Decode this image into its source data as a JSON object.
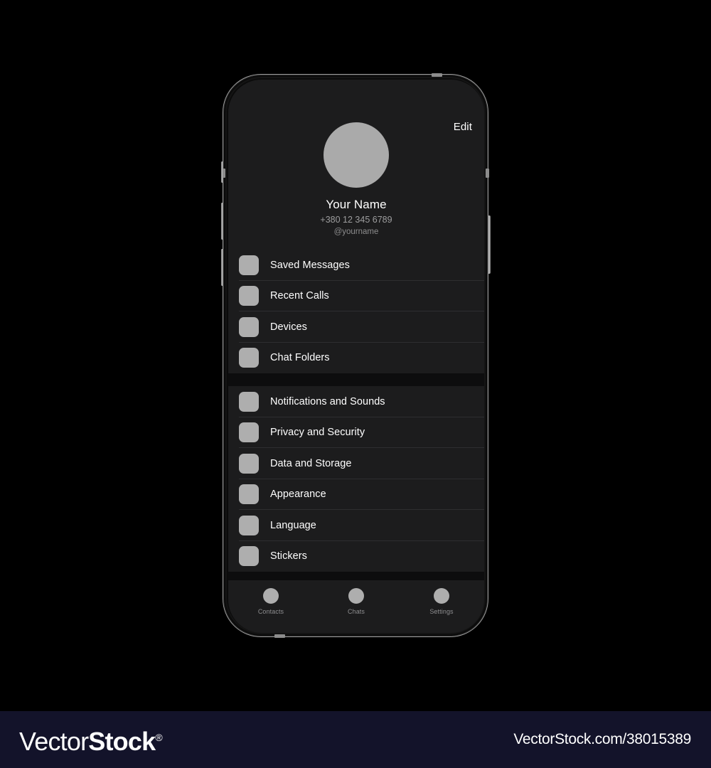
{
  "page": {
    "background_color": "#000000"
  },
  "device": {
    "type": "smartphone-mockup",
    "frame_color": "#9b9b9b",
    "screen_color": "#1c1c1d",
    "buttons": [
      {
        "name": "silent-switch"
      },
      {
        "name": "volume-up-button"
      },
      {
        "name": "volume-down-button"
      },
      {
        "name": "power-button"
      }
    ]
  },
  "screen": {
    "app": "messenger-settings",
    "header": {
      "edit_label": "Edit",
      "avatar_color": "#aaaaaa",
      "name": "Your Name",
      "phone": "+380 12 345 6789",
      "username": "@yourname"
    },
    "groups": [
      {
        "id": "group-1",
        "rows": [
          {
            "label": "Saved Messages",
            "icon": "saved-messages-icon"
          },
          {
            "label": "Recent Calls",
            "icon": "recent-calls-icon"
          },
          {
            "label": "Devices",
            "icon": "devices-icon"
          },
          {
            "label": "Chat Folders",
            "icon": "chat-folders-icon"
          }
        ]
      },
      {
        "id": "group-2",
        "rows": [
          {
            "label": "Notifications and Sounds",
            "icon": "notifications-icon"
          },
          {
            "label": "Privacy and Security",
            "icon": "privacy-icon"
          },
          {
            "label": "Data and Storage",
            "icon": "data-storage-icon"
          },
          {
            "label": "Appearance",
            "icon": "appearance-icon"
          },
          {
            "label": "Language",
            "icon": "language-icon"
          },
          {
            "label": "Stickers",
            "icon": "stickers-icon"
          }
        ]
      }
    ],
    "tab_bar": {
      "tabs": [
        {
          "label": "Contacts",
          "icon": "contacts-icon"
        },
        {
          "label": "Chats",
          "icon": "chats-icon"
        },
        {
          "label": "Settings",
          "icon": "settings-icon"
        }
      ]
    }
  },
  "footer": {
    "background_color": "#13132a",
    "logo_part_1": "Vector",
    "logo_part_2": "Stock",
    "logo_registered": "®",
    "url": "VectorStock.com/38015389"
  }
}
